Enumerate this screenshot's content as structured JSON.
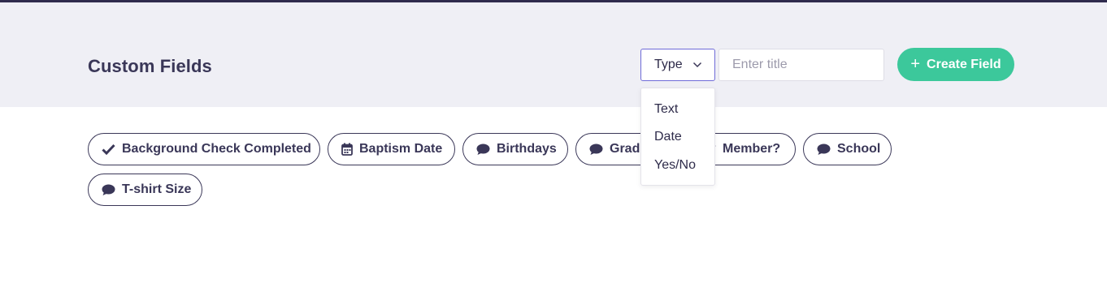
{
  "header": {
    "title": "Custom Fields",
    "type_select": {
      "label": "Type",
      "icon": "chevron-down-icon"
    },
    "title_input": {
      "placeholder": "Enter title",
      "value": ""
    },
    "create_button": {
      "label": "Create Field",
      "icon": "plus-icon",
      "color": "#3cc89b"
    }
  },
  "type_dropdown": {
    "options": [
      "Text",
      "Date",
      "Yes/No"
    ]
  },
  "fields": [
    {
      "label": "Background Check Completed",
      "icon": "check-icon"
    },
    {
      "label": "Baptism Date",
      "icon": "calendar-icon"
    },
    {
      "label": "Birthdays",
      "icon": "speech-bubble-icon"
    },
    {
      "label": "Grade",
      "icon": "speech-bubble-icon"
    },
    {
      "label": "Member?",
      "icon": "check-icon"
    },
    {
      "label": "School",
      "icon": "speech-bubble-icon"
    },
    {
      "label": "T-shirt Size",
      "icon": "speech-bubble-icon"
    }
  ],
  "colors": {
    "accent": "#6f6bd8",
    "text": "#3a3758",
    "header_bg": "#efeff5",
    "top_border": "#2f2b4d"
  }
}
